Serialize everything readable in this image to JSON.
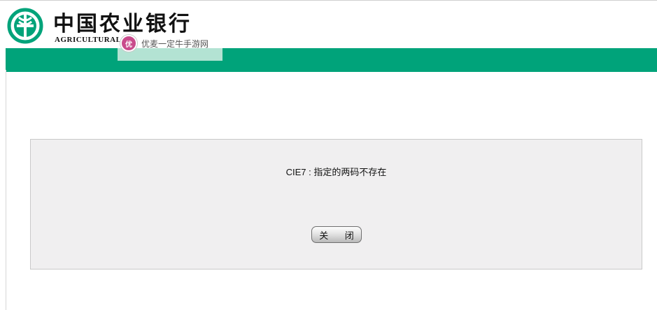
{
  "header": {
    "bank_name_cn": "中国农业银行",
    "bank_name_en": "AGRICULTURAL",
    "logo_icon": "abc-bank-logo-icon",
    "brand_color": "#00a37a"
  },
  "watermark": {
    "text": "优麦一定牛手游网",
    "logo_icon": "watermark-logo-icon",
    "logo_glyph": "优"
  },
  "dialog": {
    "message": "CIE7 : 指定的两码不存在",
    "close_label": "关 闭"
  }
}
